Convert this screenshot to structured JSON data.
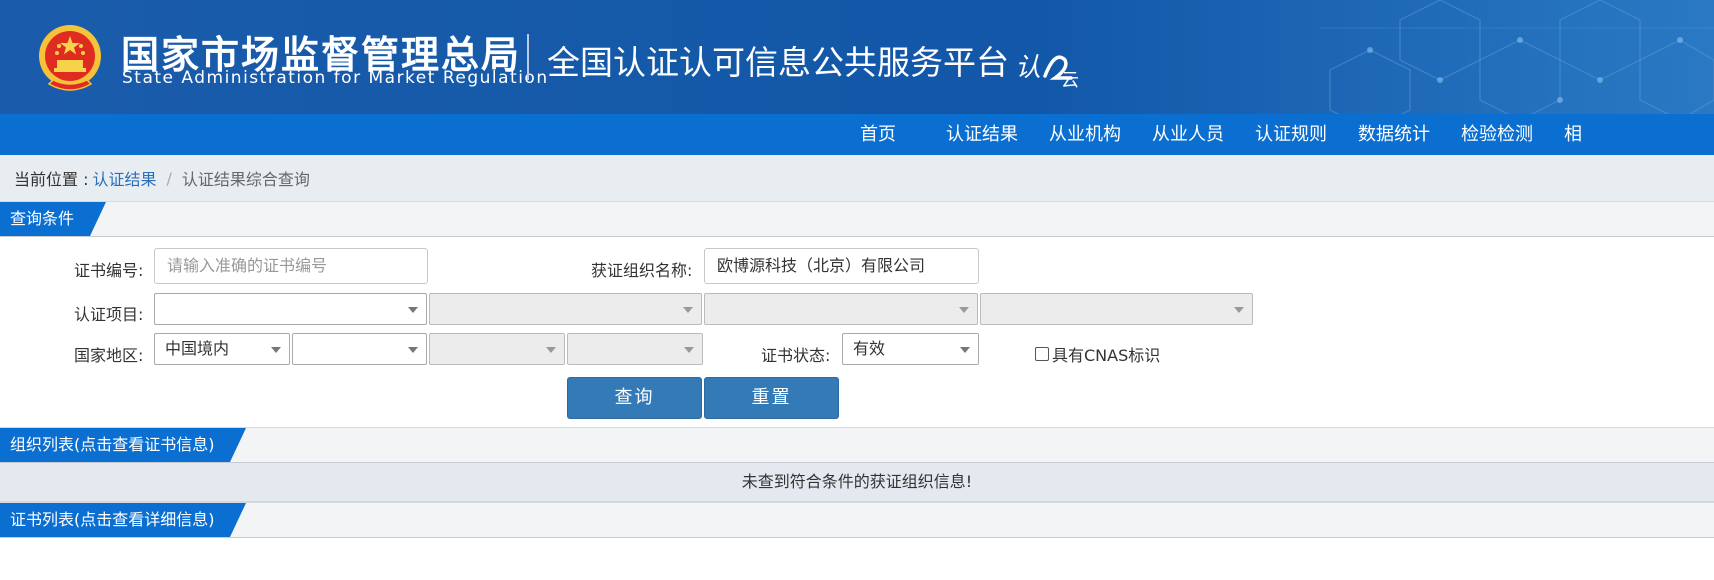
{
  "header": {
    "agency_cn": "国家市场监督管理总局",
    "agency_en": "State Administration  for  Market Regulation",
    "platform_title": "全国认证认可信息公共服务平台",
    "ren_logo_char1": "认",
    "ren_logo_char2": "云"
  },
  "nav": {
    "items": [
      "首页",
      "认证结果",
      "从业机构",
      "从业人员",
      "认证规则",
      "数据统计",
      "检验检测",
      "相"
    ]
  },
  "breadcrumb": {
    "prefix": "当前位置 :",
    "link": "认证结果",
    "separator": "/",
    "current": "认证结果综合查询"
  },
  "query": {
    "section_title": "查询条件",
    "cert_no_label": "证书编号:",
    "cert_no_placeholder": "请输入准确的证书编号",
    "org_name_label": "获证组织名称:",
    "org_name_value": "欧博源科技（北京）有限公司",
    "project_label": "认证项目:",
    "project_selects": [
      "",
      "",
      "",
      ""
    ],
    "region_label": "国家地区:",
    "region_selects": [
      "中国境内",
      "",
      "",
      ""
    ],
    "status_label": "证书状态:",
    "status_value": "有效",
    "cnas_label": "具有CNAS标识",
    "search_button": "查询",
    "reset_button": "重置"
  },
  "org_list": {
    "section_title": "组织列表(点击查看证书信息)",
    "empty_message": "未查到符合条件的获证组织信息!"
  },
  "cert_list": {
    "section_title": "证书列表(点击查看详细信息)"
  },
  "colors": {
    "header_bg": "#1257a8",
    "nav_bg": "#0b6fd2",
    "button_bg": "#337ab7",
    "crumb_link": "#2a6fba"
  }
}
